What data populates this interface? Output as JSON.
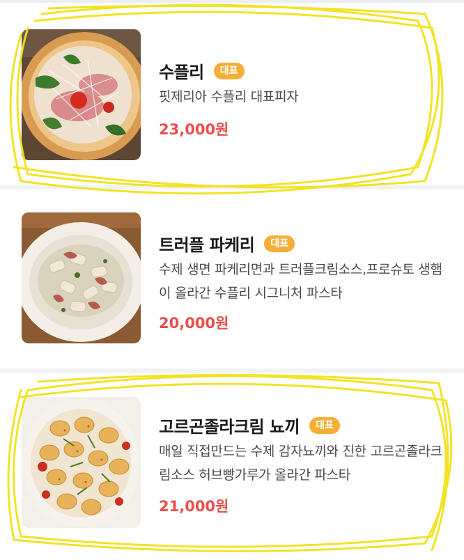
{
  "menu": {
    "items": [
      {
        "name": "수플리",
        "badge": "대표",
        "description": "핏제리아 수플리 대표피자",
        "price": "23,000원",
        "image_icon": "pizza-photo"
      },
      {
        "name": "트러플 파케리",
        "badge": "대표",
        "description": "수제 생면 파케리면과 트러플크림소스,프로슈토 생햄이 올라간 수플리 시그니처 파스타",
        "price": "20,000원",
        "image_icon": "pasta-photo"
      },
      {
        "name": "고르곤졸라크림 뇨끼",
        "badge": "대표",
        "description": "매일 직접만드는 수제 감자뇨끼와 진한 고르곤졸라크림소스 허브빵가루가 올라간 파스타",
        "price": "21,000원",
        "image_icon": "gnocchi-photo"
      }
    ]
  },
  "colors": {
    "badge": "#f6ae37",
    "price": "#e9504b",
    "highlight": "#f2e21a"
  }
}
